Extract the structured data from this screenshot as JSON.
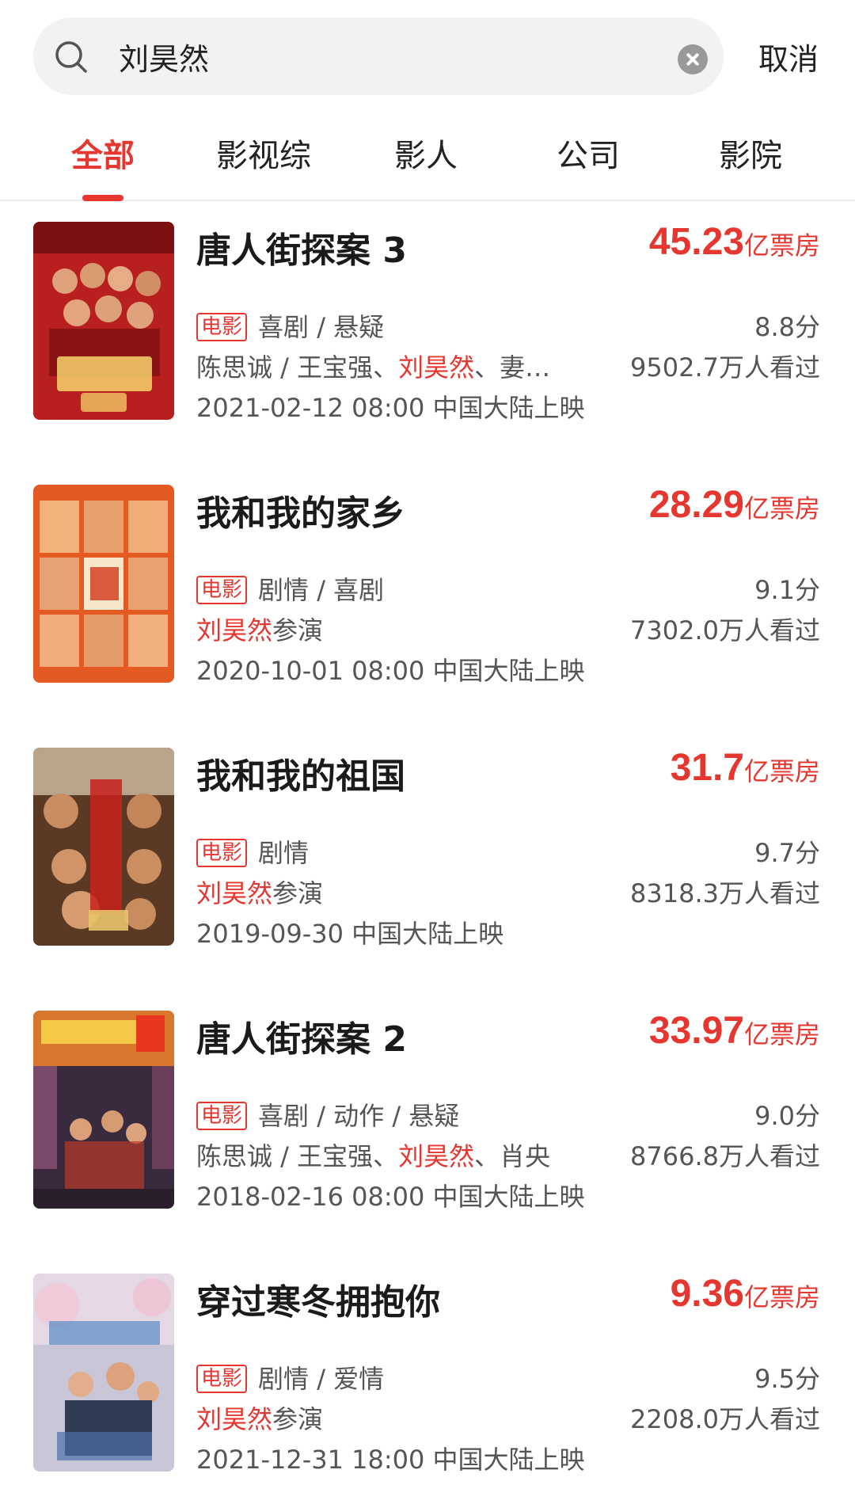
{
  "search": {
    "value": "刘昊然",
    "cancel_label": "取消"
  },
  "tabs": [
    {
      "label": "全部",
      "active": true
    },
    {
      "label": "影视综",
      "active": false
    },
    {
      "label": "影人",
      "active": false
    },
    {
      "label": "公司",
      "active": false
    },
    {
      "label": "影院",
      "active": false
    }
  ],
  "colors": {
    "accent": "#e5362f",
    "text": "#222222",
    "muted": "#555555"
  },
  "movies": [
    {
      "title": "唐人街探案 3",
      "boxoffice": "45.23",
      "boxoffice_unit": "亿票房",
      "type": "电影",
      "genres": "喜剧 / 悬疑",
      "score": "8.8分",
      "cast_before": "陈思诚 / 王宝强、",
      "cast_highlight": "刘昊然",
      "cast_after": "、妻…",
      "viewers": "9502.7万人看过",
      "release": "2021-02-12 08:00 中国大陆上映"
    },
    {
      "title": "我和我的家乡",
      "boxoffice": "28.29",
      "boxoffice_unit": "亿票房",
      "type": "电影",
      "genres": "剧情 / 喜剧",
      "score": "9.1分",
      "cast_before": "",
      "cast_highlight": "刘昊然",
      "cast_after": "参演",
      "viewers": "7302.0万人看过",
      "release": "2020-10-01 08:00 中国大陆上映"
    },
    {
      "title": "我和我的祖国",
      "boxoffice": "31.7",
      "boxoffice_unit": "亿票房",
      "type": "电影",
      "genres": "剧情",
      "score": "9.7分",
      "cast_before": "",
      "cast_highlight": "刘昊然",
      "cast_after": "参演",
      "viewers": "8318.3万人看过",
      "release": "2019-09-30 中国大陆上映"
    },
    {
      "title": "唐人街探案 2",
      "boxoffice": "33.97",
      "boxoffice_unit": "亿票房",
      "type": "电影",
      "genres": "喜剧 / 动作 / 悬疑",
      "score": "9.0分",
      "cast_before": "陈思诚 / 王宝强、",
      "cast_highlight": "刘昊然",
      "cast_after": "、肖央",
      "viewers": "8766.8万人看过",
      "release": "2018-02-16 08:00 中国大陆上映"
    },
    {
      "title": "穿过寒冬拥抱你",
      "boxoffice": "9.36",
      "boxoffice_unit": "亿票房",
      "type": "电影",
      "genres": "剧情 / 爱情",
      "score": "9.5分",
      "cast_before": "",
      "cast_highlight": "刘昊然",
      "cast_after": "参演",
      "viewers": "2208.0万人看过",
      "release": "2021-12-31 18:00 中国大陆上映"
    }
  ]
}
